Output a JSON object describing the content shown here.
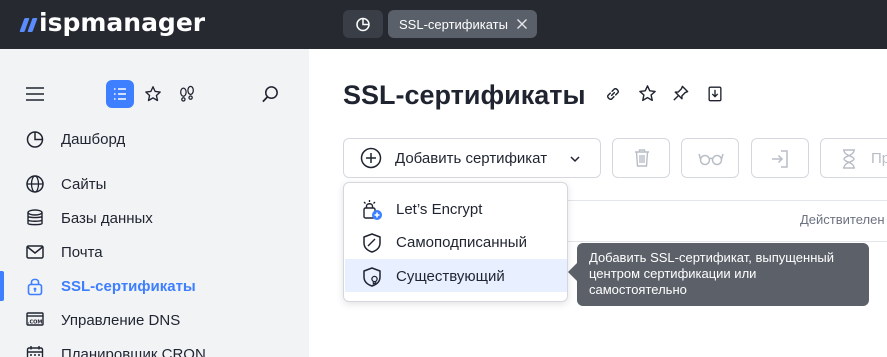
{
  "app": {
    "logo_text": "ispmanager",
    "brand_color": "#5b8cff",
    "accent_color": "#3d7fff"
  },
  "top_tabs": [
    {
      "icon": "dashboard-icon"
    },
    {
      "label": "SSL-сертификаты",
      "icon": "close-icon"
    }
  ],
  "sidebar": {
    "tools": [
      "menu-icon",
      "list-view-icon",
      "star-icon",
      "footprints-icon",
      "search-icon"
    ],
    "items": [
      {
        "label": "Дашборд",
        "icon": "dashboard-icon"
      },
      {
        "label": "Сайты",
        "icon": "globe-icon"
      },
      {
        "label": "Базы данных",
        "icon": "database-icon"
      },
      {
        "label": "Почта",
        "icon": "mail-icon"
      },
      {
        "label": "SSL-сертификаты",
        "icon": "lock-icon",
        "active": true
      },
      {
        "label": "Управление DNS",
        "icon": "dns-icon"
      },
      {
        "label": "Планировщик CRON",
        "icon": "calendar-icon"
      }
    ]
  },
  "main": {
    "title": "SSL-сертификаты",
    "title_icons": [
      "link-icon",
      "star-icon",
      "pin-icon",
      "export-icon"
    ],
    "add_button_label": "Добавить сертификат",
    "toolbar_partial_label": "Пр",
    "column_header": "Действителен"
  },
  "dropdown": {
    "items": [
      {
        "label": "Let’s Encrypt",
        "icon": "lets-encrypt-icon"
      },
      {
        "label": "Самоподписанный",
        "icon": "shield-icon"
      },
      {
        "label": "Существующий",
        "icon": "certificate-shield-icon",
        "hover": true
      }
    ]
  },
  "tooltip": {
    "text": "Добавить SSL-сертификат, выпущенный центром сертификации или самостоятельно"
  }
}
